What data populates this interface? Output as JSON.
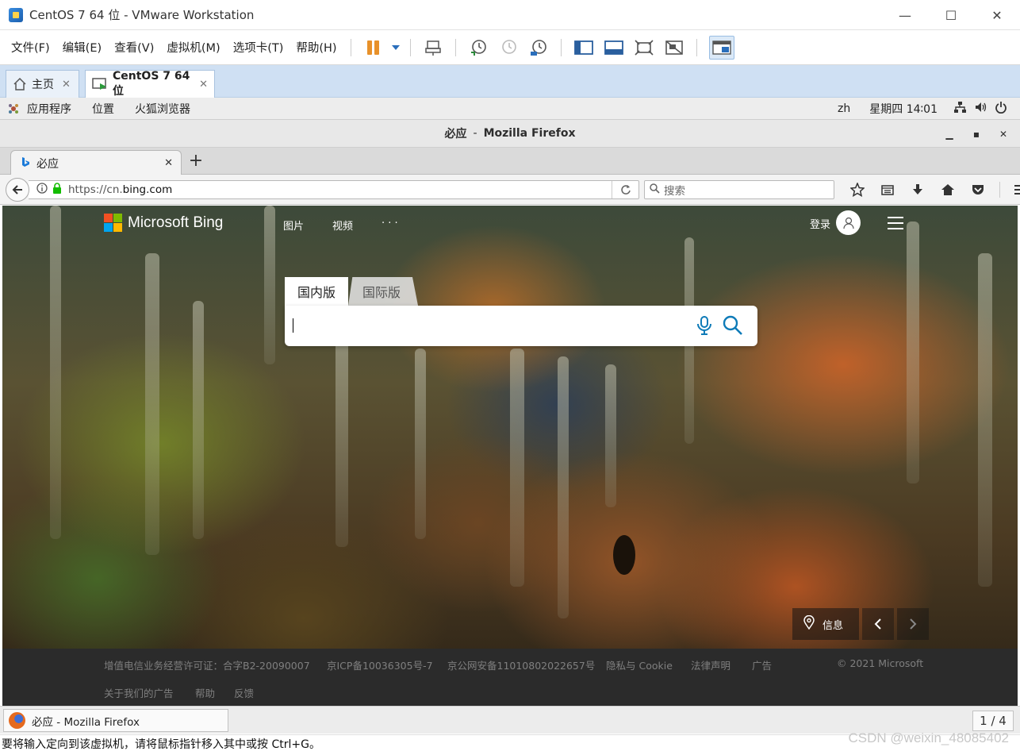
{
  "vmware": {
    "title": "CentOS 7 64 位 - VMware Workstation",
    "menu": [
      "文件(F)",
      "编辑(E)",
      "查看(V)",
      "虚拟机(M)",
      "选项卡(T)",
      "帮助(H)"
    ],
    "tabs": [
      {
        "label": "主页",
        "icon": "home-icon"
      },
      {
        "label": "CentOS 7 64 位",
        "icon": "vm-icon"
      }
    ],
    "status_text": "要将输入定向到该虚拟机，请将鼠标指针移入其中或按 Ctrl+G。"
  },
  "gnome": {
    "menu": [
      "应用程序",
      "位置",
      "火狐浏览器"
    ],
    "lang": "zh",
    "clock": "星期四 14∶01",
    "taskbar_item": "必应 - Mozilla Firefox",
    "workspace": "1 / 4"
  },
  "firefox": {
    "window_title": "必应 - Mozilla Firefox",
    "window_title_page": "必应",
    "window_title_app": "Mozilla Firefox",
    "tab_title": "必应",
    "url_prefix": "https://cn.",
    "url_domain": "bing.com",
    "search_placeholder": "搜索"
  },
  "bing": {
    "logo_text": "Microsoft Bing",
    "nav": [
      "图片",
      "视频",
      "· · ·"
    ],
    "login": "登录",
    "tabs": [
      "国内版",
      "国际版"
    ],
    "info_label": "信息",
    "footer_row1": [
      "增值电信业务经营许可证：合字B2-20090007",
      "京ICP备10036305号-7",
      "京公网安备11010802022657号",
      "隐私与 Cookie",
      "法律声明",
      "广告"
    ],
    "copyright": "© 2021 Microsoft",
    "footer_row2": [
      "关于我们的广告",
      "帮助",
      "反馈"
    ],
    "logo_colors": [
      "#f25022",
      "#7fba00",
      "#00a4ef",
      "#ffb900"
    ]
  },
  "watermark": "CSDN @weixin_48085402"
}
